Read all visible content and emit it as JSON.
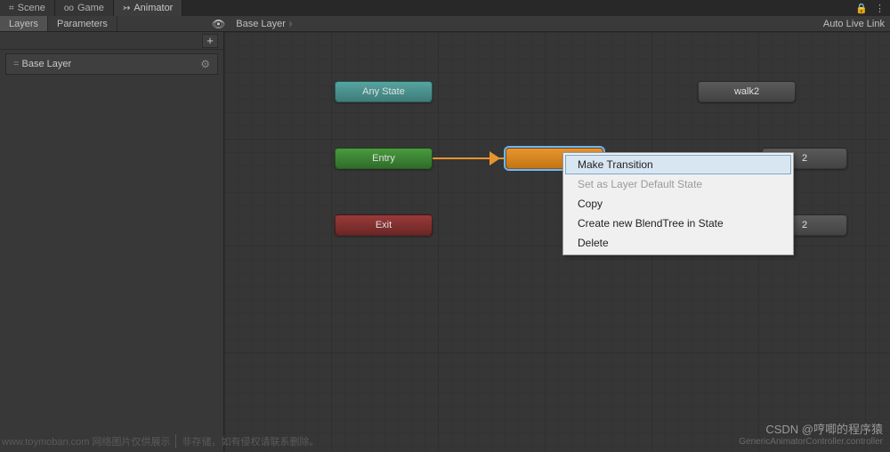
{
  "tabs": {
    "scene": "Scene",
    "game": "Game",
    "animator": "Animator"
  },
  "subtabs": {
    "layers": "Layers",
    "parameters": "Parameters"
  },
  "breadcrumb": "Base Layer",
  "autolive": "Auto Live Link",
  "sidebar": {
    "add": "+",
    "layer0": "Base Layer"
  },
  "nodes": {
    "anystate": "Any State",
    "entry": "Entry",
    "exit": "Exit",
    "default": "",
    "walk2": "walk2",
    "idle2": "2",
    "attack2": "2"
  },
  "menu": {
    "make_transition": "Make Transition",
    "set_default": "Set as Layer Default State",
    "copy": "Copy",
    "create_blendtree": "Create new BlendTree in State",
    "delete": "Delete"
  },
  "footer": {
    "watermark": "www.toymoban.com 网络图片仅供展示",
    "note": "非存储，如有侵权请联系删除。",
    "csdn": "CSDN @哼唧的程序猿",
    "path": "GenericAnimatorController.controller"
  }
}
